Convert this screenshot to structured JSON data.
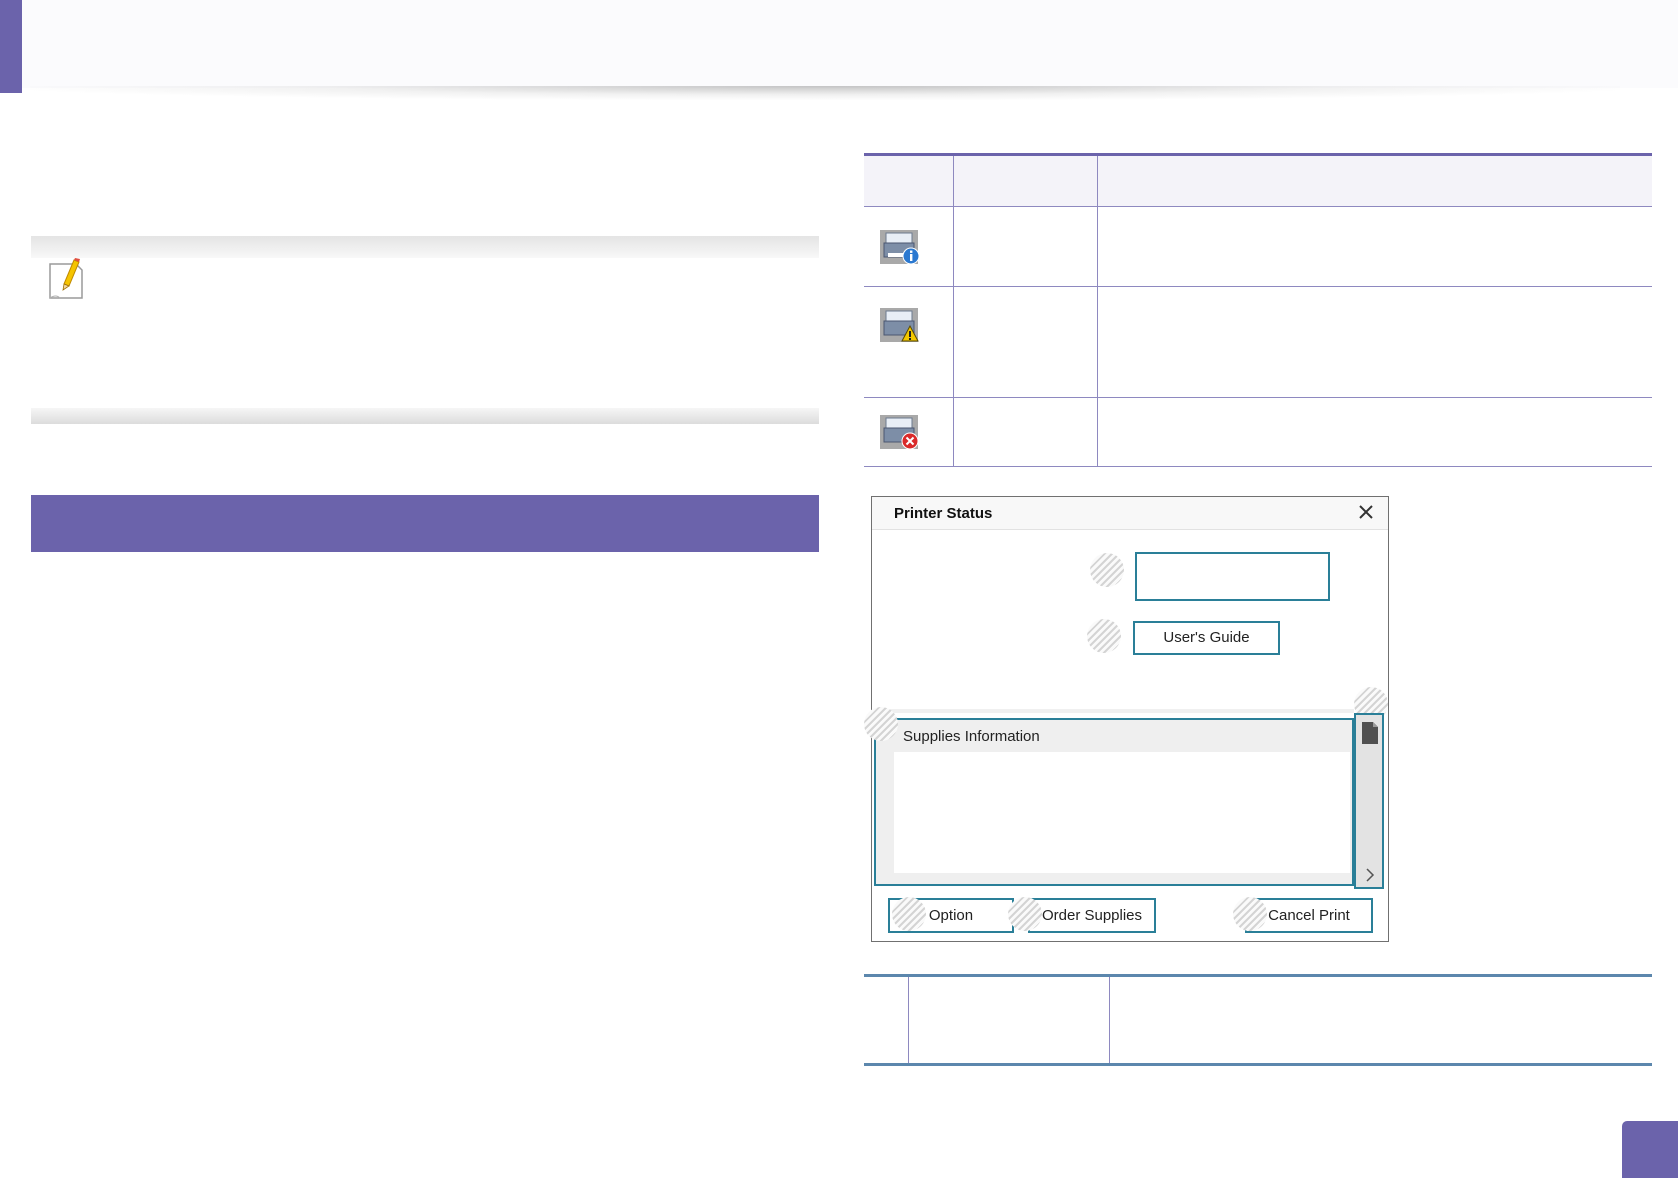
{
  "status_icons": [
    {
      "icon": "printer-info-icon"
    },
    {
      "icon": "printer-warning-icon"
    },
    {
      "icon": "printer-error-icon"
    }
  ],
  "printer_status": {
    "title": "Printer Status",
    "user_guide_label": "User's Guide",
    "supplies_title": "Supplies Information",
    "option_label": "Option",
    "order_supplies_label": "Order Supplies",
    "cancel_print_label": "Cancel Print"
  },
  "colors": {
    "accent": "#6b63ab",
    "control_border": "#2a7f98",
    "table_rule": "#5c87ad"
  }
}
